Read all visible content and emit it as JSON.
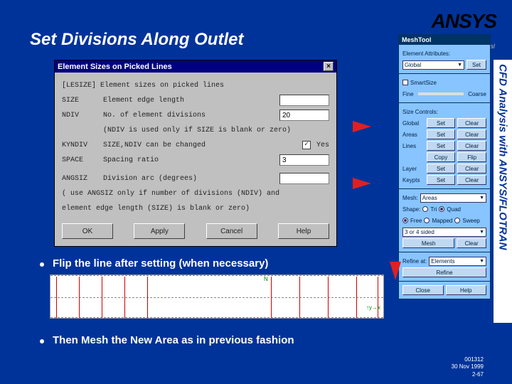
{
  "title": "Set Divisions Along Outlet",
  "logo": "ANSYS",
  "tagline": "...a virtual",
  "side_label": "CFD Analysis with ANSYS/FLOTRAN",
  "footer": {
    "code": "001312",
    "date": "30 Nov 1999",
    "page": "2-67"
  },
  "bullets": {
    "b1": "Flip the line after setting (when necessary)",
    "b2": "Then Mesh the New Area as in previous fashion"
  },
  "dlg": {
    "title": "Element Sizes on Picked Lines",
    "head": "[LESIZE]  Element sizes on picked lines",
    "size_lab": "SIZE",
    "size_txt": "Element edge length",
    "size_val": "",
    "ndiv_lab": "NDIV",
    "ndiv_txt": "No. of element divisions",
    "ndiv_val": "20",
    "ndiv_note": "(NDIV is used only if SIZE is blank or zero)",
    "kynd_lab": "KYNDIV",
    "kynd_txt": "SIZE,NDIV can be changed",
    "kynd_chk": "✓",
    "kynd_yes": "Yes",
    "space_lab": "SPACE",
    "space_txt": "Spacing ratio",
    "space_val": "3",
    "ang_lab": "ANGSIZ",
    "ang_txt": "Division arc (degrees)",
    "ang_val": "",
    "ang_note": "( use ANGSIZ only if number of divisions (NDIV) and",
    "ang_note2": "element edge length (SIZE) is blank or zero)",
    "btns": {
      "ok": "OK",
      "apply": "Apply",
      "cancel": "Cancel",
      "help": "Help"
    }
  },
  "mesh": {
    "title": "MeshTool",
    "elem_attr": "Element Attributes:",
    "global": "Global",
    "set": "Set",
    "smart": "SmartSize",
    "fine": "Fine",
    "coarse": "Coarse",
    "szctrl": "Size Controls:",
    "rows": [
      {
        "l": "Global",
        "b1": "Set",
        "b2": "Clear"
      },
      {
        "l": "Areas",
        "b1": "Set",
        "b2": "Clear"
      },
      {
        "l": "Lines",
        "b1": "Set",
        "b2": "Clear"
      },
      {
        "l": "",
        "b1": "Copy",
        "b2": "Flip"
      },
      {
        "l": "Layer",
        "b1": "Set",
        "b2": "Clear"
      },
      {
        "l": "Keypts",
        "b1": "Set",
        "b2": "Clear"
      }
    ],
    "mesh_lab": "Mesh:",
    "mesh_val": "Areas",
    "shape_lab": "Shape:",
    "shape_tri": "Tri",
    "shape_quad": "Quad",
    "free": "Free",
    "mapped": "Mapped",
    "sweep": "Sweep",
    "opt": "3 or 4 sided",
    "mesh_btn": "Mesh",
    "clear_btn": "Clear",
    "refine_lab": "Refine at:",
    "refine_val": "Elements",
    "refine_btn": "Refine",
    "close": "Close",
    "help": "Help"
  },
  "flip_N": "N"
}
